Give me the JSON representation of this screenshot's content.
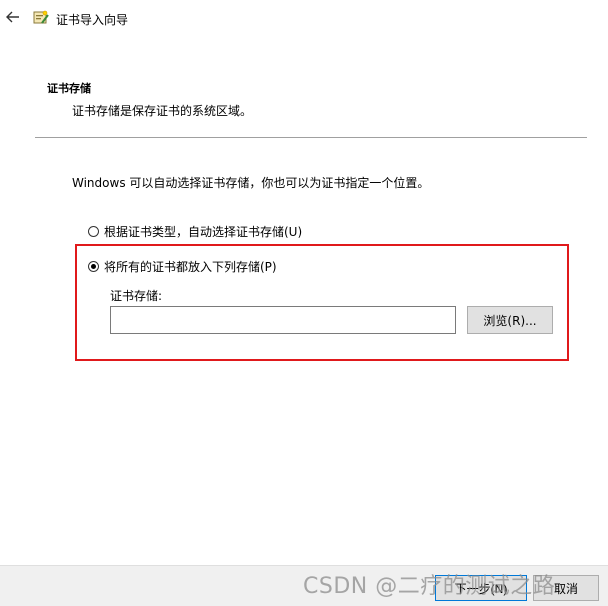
{
  "window": {
    "title": "证书导入向导"
  },
  "section": {
    "heading": "证书存储",
    "description": "证书存储是保存证书的系统区域。"
  },
  "intro": "Windows 可以自动选择证书存储，你也可以为证书指定一个位置。",
  "options": {
    "auto": {
      "label": "根据证书类型，自动选择证书存储(U)",
      "selected": false
    },
    "manual": {
      "label": "将所有的证书都放入下列存储(P)",
      "selected": true
    }
  },
  "store": {
    "label": "证书存储:",
    "value": "",
    "browse_label": "浏览(R)..."
  },
  "footer": {
    "next_label": "下一步(N)",
    "cancel_label": "取消"
  },
  "watermark": "CSDN @二疗的测试之路",
  "colors": {
    "highlight": "#e0191b",
    "accent": "#0078d7",
    "footer_bg": "#f0f0f0"
  }
}
